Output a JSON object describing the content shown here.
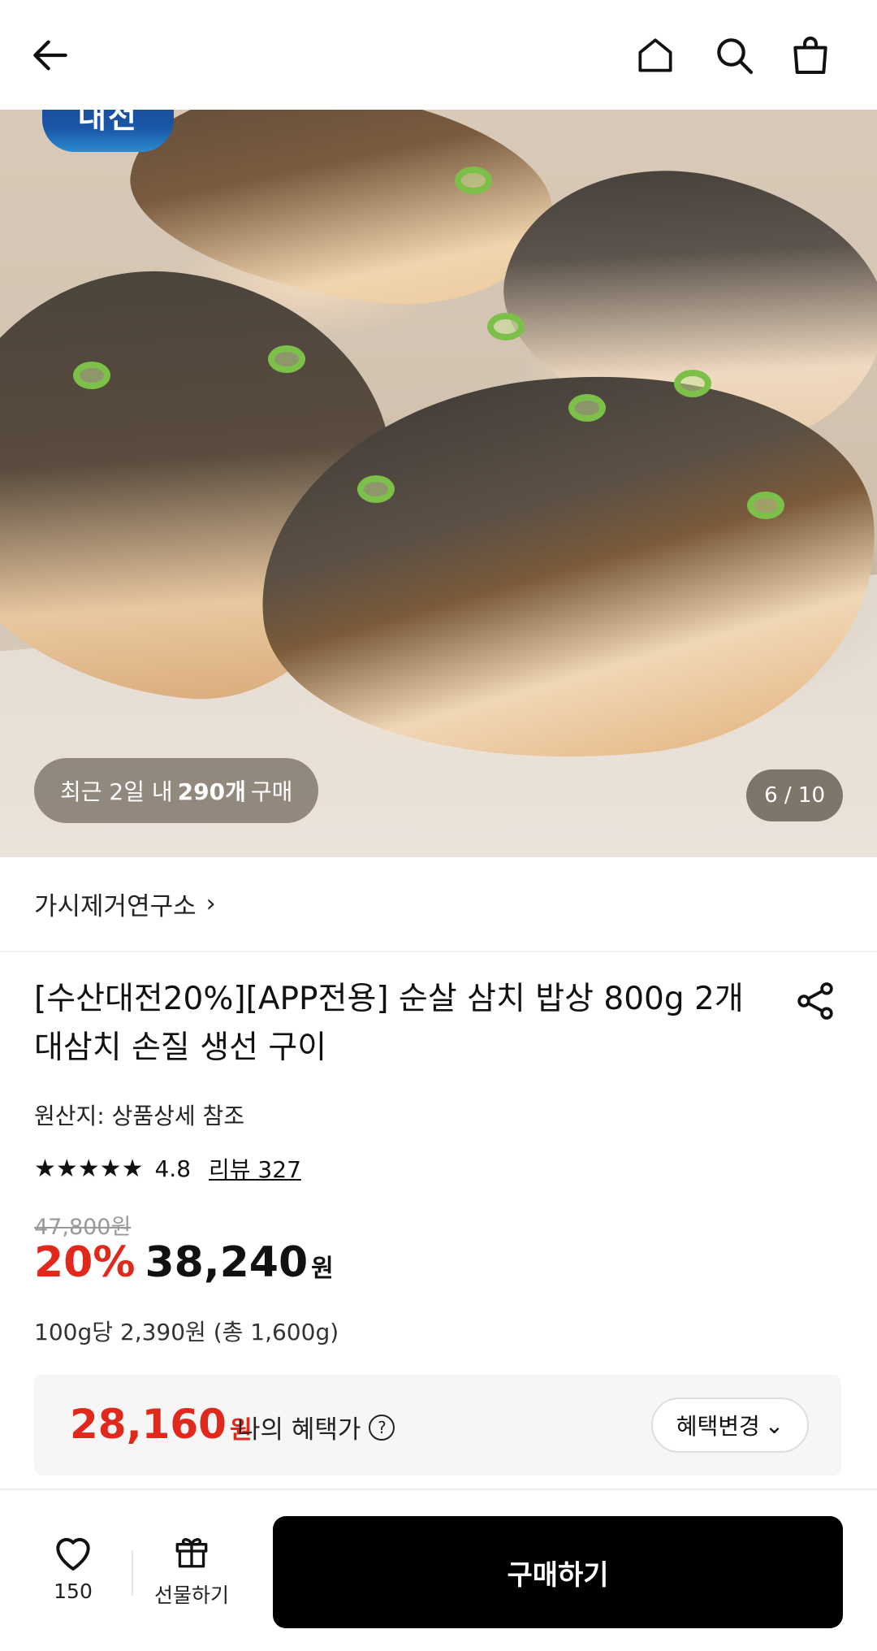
{
  "hero": {
    "recent_prefix": "최근 2일 내",
    "recent_count": "290개",
    "recent_suffix": "구매",
    "page_indicator": "6 / 10",
    "logo_text": "대전"
  },
  "brand": {
    "name": "가시제거연구소",
    "chevron": "›"
  },
  "product": {
    "title": "[수산대전20%][APP전용] 순살 삼치 밥상 800g 2개 대삼치 손질 생선 구이",
    "origin": "원산지: 상품상세 참조",
    "stars": "★★★★★",
    "score": "4.8",
    "review_link": "리뷰 327",
    "original_price": "47,800원",
    "discount": "20%",
    "price": "38,240",
    "price_unit": "원",
    "unit_price": "100g당 2,390원 (총 1,600g)"
  },
  "benefit": {
    "price": "28,160",
    "unit": "원",
    "label": "나의 혜택가",
    "help": "?",
    "change_button": "혜택변경",
    "change_chevron": "⌄"
  },
  "bottom": {
    "wish_count": "150",
    "gift_label": "선물하기",
    "buy_label": "구매하기"
  },
  "icons": [
    "back-arrow-icon",
    "home-icon",
    "search-icon",
    "shopping-bag-icon",
    "share-icon",
    "heart-icon",
    "gift-icon",
    "question-icon",
    "chevron-right-icon",
    "chevron-down-icon",
    "star-icon"
  ],
  "colors": {
    "accent_red": "#e0281c",
    "buy_button": "#000000",
    "benefit_bg": "#f6f6f6"
  }
}
